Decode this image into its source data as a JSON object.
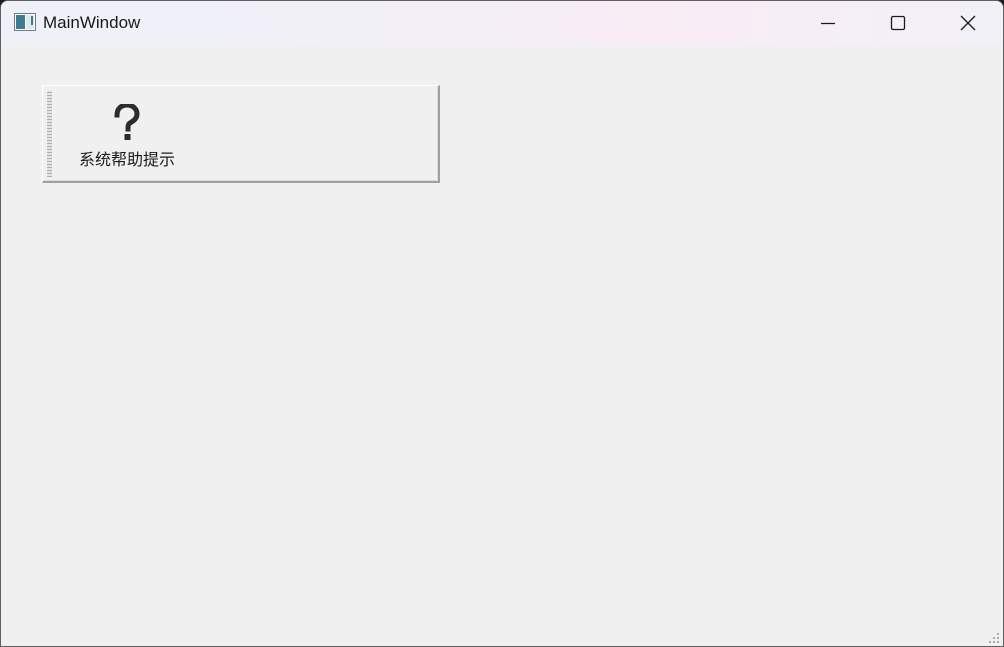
{
  "window": {
    "title": "MainWindow",
    "icon": "app-window-icon",
    "caption_buttons": [
      "minimize-icon",
      "maximize-icon",
      "close-icon"
    ]
  },
  "toolbar": {
    "buttons": [
      {
        "label": "系统帮助提示",
        "icon": "help-question-icon"
      }
    ]
  }
}
